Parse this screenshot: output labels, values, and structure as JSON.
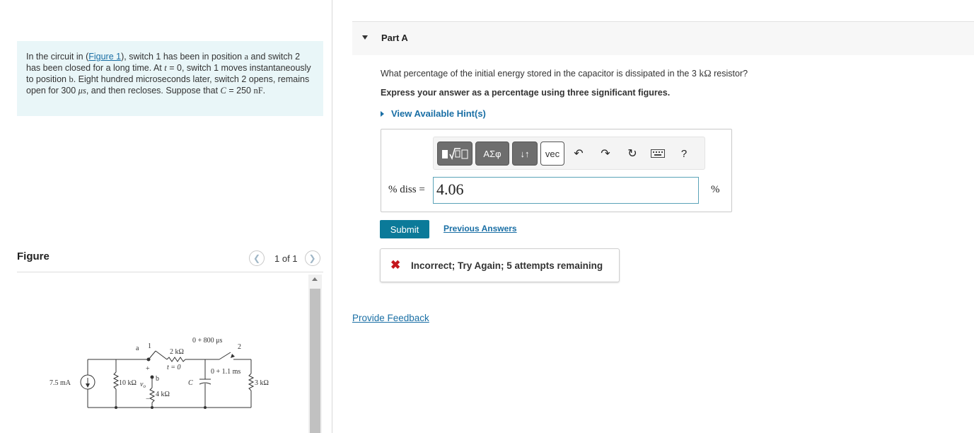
{
  "problem": {
    "intro": "In the circuit in (",
    "figure_link": "Figure 1",
    "text_1": "), switch 1 has been in position ",
    "pos_a": "a",
    "text_2": " and switch 2 has been closed for a long time. At ",
    "t_var": "t",
    "text_3": " = 0, switch 1 moves instantaneously to position ",
    "pos_b": "b",
    "text_4": ". Eight hundred microseconds later, switch 2 opens, remains open for 300 ",
    "mu": "μs",
    "text_5": ", and then recloses. Suppose that ",
    "c_var": "C",
    "text_6": " = 250 ",
    "unit_nf": "nF",
    "text_7": "."
  },
  "figure": {
    "heading": "Figure",
    "count": "1 of 1",
    "prev_icon": "chevron-left-icon",
    "next_icon": "chevron-right-icon",
    "circuit_labels": {
      "source": "7.5 mA",
      "r10": "10 kΩ",
      "r2": "2 kΩ",
      "r4": "4 kΩ",
      "r3": "3 kΩ",
      "cap": "C",
      "vo": "v",
      "vo_sub": "o",
      "a": "a",
      "b": "b",
      "sw1": "1",
      "sw2": "2",
      "t0": "t = 0",
      "t800": "0 + 800 μs",
      "t11": "0 + 1.1 ms",
      "plus": "+",
      "minus": "−"
    }
  },
  "part": {
    "title": "Part A",
    "question_pre": "What percentage of the initial energy stored in the capacitor is dissipated in the 3 ",
    "question_unit": "kΩ",
    "question_post": " resistor?",
    "instruction": "Express your answer as a percentage using three significant figures.",
    "hint": "View Available Hint(s)"
  },
  "toolbar": {
    "templates_icon": "math-templates-icon",
    "greek_label": "ΑΣφ",
    "updown_label": "↓↑",
    "vec_label": "vec",
    "undo_icon": "undo-icon",
    "redo_icon": "redo-icon",
    "reset_icon": "reset-icon",
    "keyboard_icon": "keyboard-icon",
    "help_label": "?"
  },
  "answer": {
    "label": "% diss =",
    "value": "4.06",
    "unit": "%"
  },
  "actions": {
    "submit": "Submit",
    "previous_answers": "Previous Answers"
  },
  "feedback": {
    "icon": "x-icon",
    "message": "Incorrect; Try Again; 5 attempts remaining",
    "provide_feedback": "Provide Feedback"
  }
}
